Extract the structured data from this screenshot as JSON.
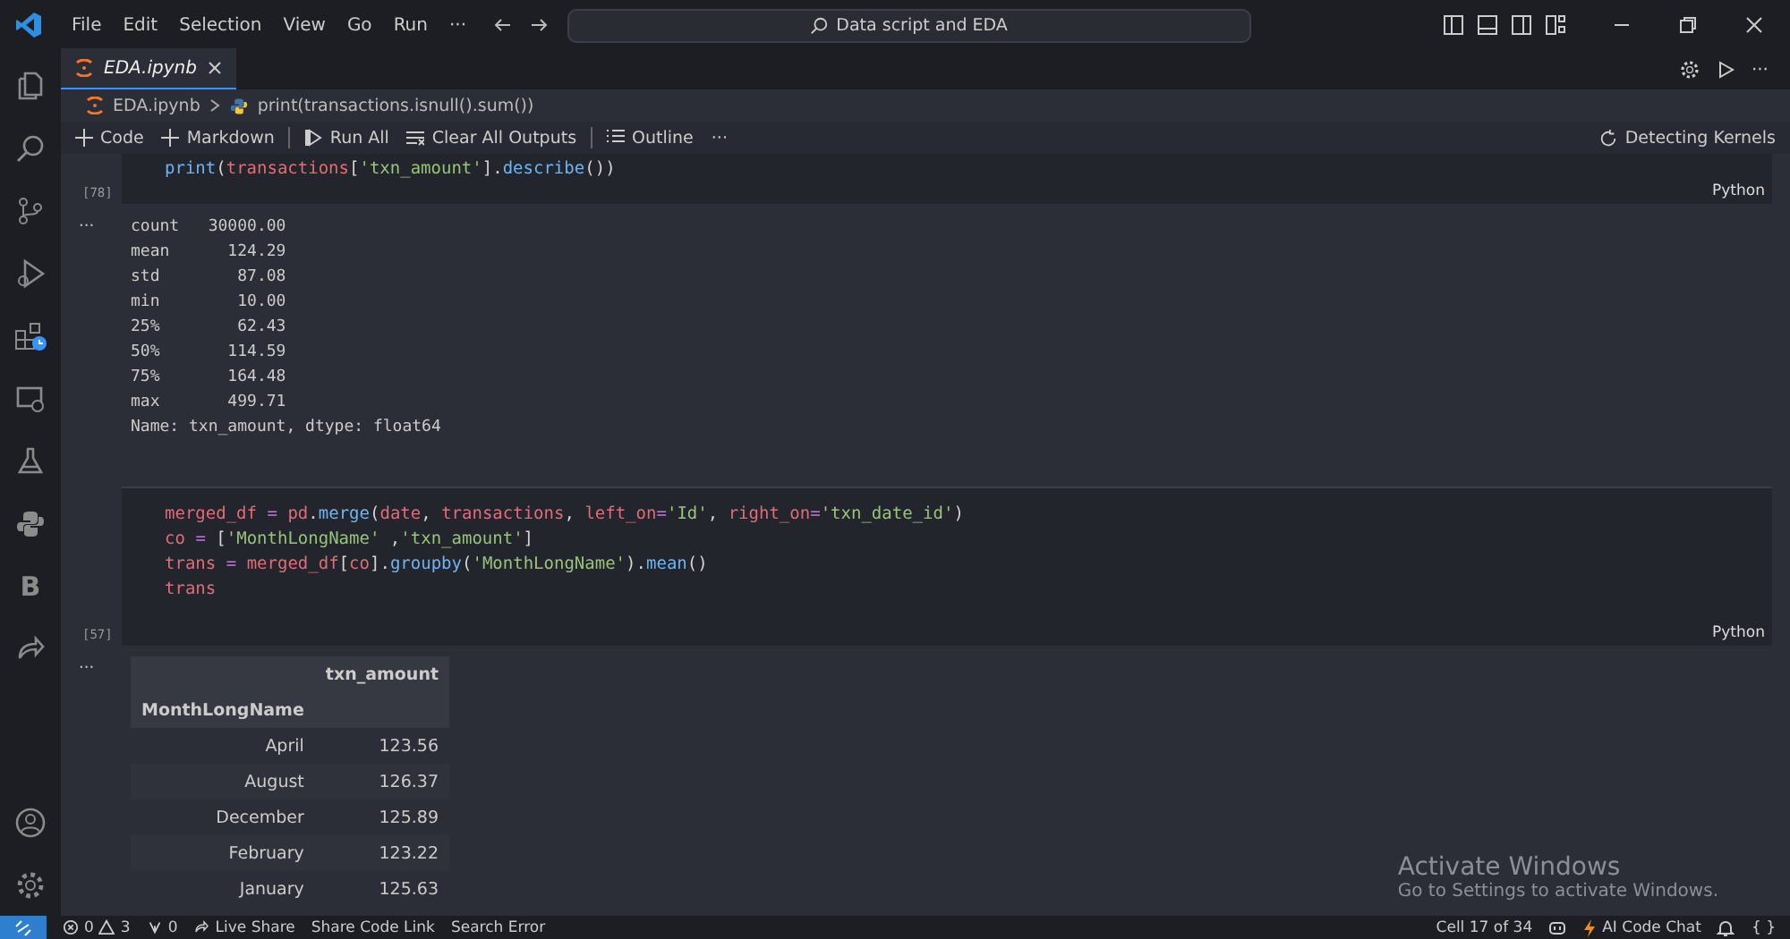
{
  "menu": [
    "File",
    "Edit",
    "Selection",
    "View",
    "Go",
    "Run",
    "···"
  ],
  "command_center": {
    "value": "Data script and EDA"
  },
  "activity_bar": [
    {
      "kind": "files",
      "selected": false
    },
    {
      "kind": "search",
      "selected": false
    },
    {
      "kind": "scm",
      "selected": false
    },
    {
      "kind": "debug",
      "selected": false
    },
    {
      "kind": "extensions",
      "selected": false
    },
    {
      "kind": "remote",
      "selected": false
    },
    {
      "kind": "flask",
      "selected": false
    },
    {
      "kind": "python",
      "selected": false
    },
    {
      "kind": "letter",
      "label": "B",
      "selected": false
    },
    {
      "kind": "share",
      "selected": false
    }
  ],
  "tabs": [
    {
      "label": "EDA.ipynb",
      "selected": true
    }
  ],
  "breadcrumb": [
    "EDA.ipynb",
    "print(transactions.isnull().sum())"
  ],
  "toolbar": [
    {
      "kind": "add",
      "label": "Code"
    },
    {
      "kind": "add",
      "label": "Markdown"
    },
    {
      "kind": "run",
      "label": "Run All"
    },
    {
      "kind": "clear",
      "label": "Clear All Outputs"
    },
    {
      "kind": "outline",
      "label": "Outline"
    },
    {
      "kind": "more",
      "label": "···"
    }
  ],
  "kernel": "Detecting Kernels",
  "editor_more": "···",
  "cells": [
    {
      "count": "[78]",
      "language": "Python",
      "code": [
        "print(transactions['txn_amount'].describe())"
      ],
      "output": {
        "kind": "text",
        "more": "···",
        "lines": [
          "count   30000.00",
          "mean      124.29",
          "std        87.08",
          "min        10.00",
          "25%        62.43",
          "50%       114.59",
          "75%       164.48",
          "max       499.71",
          "Name: txn_amount, dtype: float64"
        ]
      }
    },
    {
      "count": "[57]",
      "language": "Python",
      "code": [
        "merged_df = pd.merge(date, transactions, left_on='Id', right_on='txn_date_id')",
        "co = ['MonthLongName' ,'txn_amount']",
        "trans = merged_df[co].groupby('MonthLongName').mean()",
        "trans"
      ],
      "output": {
        "kind": "table",
        "more": "···",
        "header_rows": [
          [
            "",
            "txn_amount"
          ],
          [
            "MonthLongName",
            ""
          ]
        ],
        "rows": [
          [
            "April",
            "123.56"
          ],
          [
            "August",
            "126.37"
          ],
          [
            "December",
            "125.89"
          ],
          [
            "February",
            "123.22"
          ],
          [
            "January",
            "125.63"
          ]
        ]
      }
    }
  ],
  "watermark": {
    "title": "Activate Windows",
    "subtitle": "Go to Settings to activate Windows."
  },
  "status_left": [
    {
      "kind": "errors",
      "errors": "0",
      "warnings": "3"
    },
    {
      "kind": "ports",
      "label": "0"
    },
    {
      "kind": "liveshare",
      "label": "Live Share"
    },
    {
      "kind": "text",
      "label": "Share Code Link"
    },
    {
      "kind": "text",
      "label": "Search Error"
    }
  ],
  "status_right": [
    {
      "kind": "text",
      "label": "Cell 17 of 34"
    },
    {
      "kind": "copilot"
    },
    {
      "kind": "ai",
      "label": "AI Code Chat"
    },
    {
      "kind": "bell"
    },
    {
      "kind": "braces",
      "label": "{ }"
    }
  ]
}
